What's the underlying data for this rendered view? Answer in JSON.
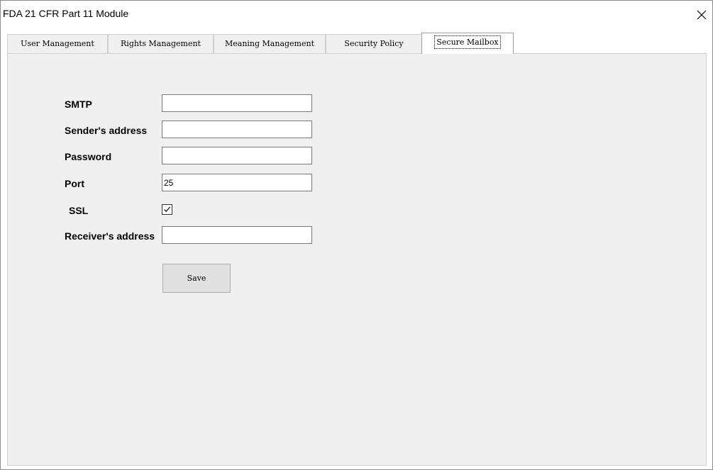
{
  "window": {
    "title": "FDA 21 CFR Part 11 Module",
    "close_label": "close"
  },
  "tabs": [
    {
      "label": "User Management",
      "active": false
    },
    {
      "label": "Rights Management",
      "active": false
    },
    {
      "label": "Meaning Management",
      "active": false
    },
    {
      "label": "Security Policy",
      "active": false
    },
    {
      "label": "Secure Mailbox",
      "active": true
    }
  ],
  "form": {
    "smtp": {
      "label": "SMTP",
      "value": ""
    },
    "sender_address": {
      "label": "Sender's address",
      "value": ""
    },
    "password": {
      "label": "Password",
      "value": ""
    },
    "port": {
      "label": "Port",
      "value": "25"
    },
    "ssl": {
      "label": "SSL",
      "checked": true
    },
    "receiver_address": {
      "label": "Receiver's address",
      "value": ""
    },
    "save_label": "Save"
  },
  "icons": {
    "close": "close-icon",
    "checkmark": "check-icon"
  },
  "colors": {
    "panel_background": "#f0f0f0",
    "button_background": "#e1e1e1"
  }
}
